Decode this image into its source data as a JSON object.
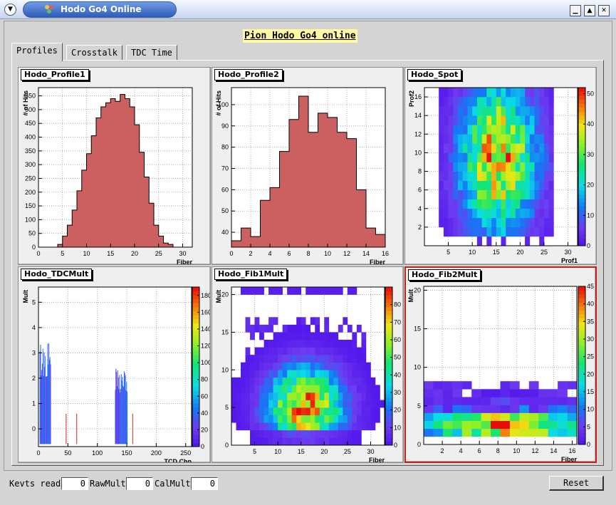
{
  "window": {
    "title": "Hodo Go4 Online"
  },
  "header": {
    "banner": "Pion Hodo Go4 online"
  },
  "tabs": [
    {
      "label": "Profiles",
      "active": true
    },
    {
      "label": "Crosstalk",
      "active": false
    },
    {
      "label": "TDC Time",
      "active": false
    }
  ],
  "pads": {
    "profile1": {
      "title": "Hodo_Profile1"
    },
    "profile2": {
      "title": "Hodo_Profile2"
    },
    "spot": {
      "title": "Hodo_Spot"
    },
    "tdcmult": {
      "title": "Hodo_TDCMult"
    },
    "fib1mult": {
      "title": "Hodo_Fib1Mult"
    },
    "fib2mult": {
      "title": "Hodo_Fib2Mult"
    }
  },
  "status": {
    "kevts_label": "Kevts read",
    "kevts_value": "0",
    "rawmult_label": "RawMult",
    "rawmult_value": "0",
    "calmult_label": "CalMult",
    "calmult_value": "0",
    "reset_label": "Reset"
  },
  "colors": {
    "hist_fill": "#cc6060",
    "selected_border": "#c81e1e",
    "banner_bg": "#fffaa0"
  },
  "chart_data": [
    {
      "type": "bar",
      "title": "Hodo_Profile1",
      "xlabel": "Fiber",
      "ylabel": "# of Hits",
      "xlim": [
        0,
        32
      ],
      "ylim": [
        0,
        580
      ],
      "xticks": [
        0,
        5,
        10,
        15,
        20,
        25,
        30
      ],
      "yticks": [
        0,
        50,
        100,
        150,
        200,
        250,
        300,
        350,
        400,
        450,
        500,
        550
      ],
      "bins": {
        "start": 0,
        "width": 1
      },
      "values": [
        0,
        0,
        0,
        0,
        10,
        40,
        80,
        135,
        205,
        280,
        340,
        405,
        470,
        510,
        525,
        540,
        530,
        555,
        540,
        510,
        445,
        345,
        255,
        160,
        80,
        40,
        15,
        10,
        0,
        0,
        0,
        0
      ]
    },
    {
      "type": "bar",
      "title": "Hodo_Profile2",
      "xlabel": "Fiber",
      "ylabel": "# of Hits",
      "xlim": [
        0,
        16
      ],
      "ylim": [
        33,
        108
      ],
      "xticks": [
        0,
        2,
        4,
        6,
        8,
        10,
        12,
        14,
        16
      ],
      "yticks": [
        40,
        50,
        60,
        70,
        80,
        90,
        100
      ],
      "bins": {
        "start": 0,
        "width": 1
      },
      "values": [
        36,
        42,
        38,
        55,
        61,
        78,
        93,
        104,
        87,
        96,
        94,
        87,
        84,
        60,
        42,
        39
      ]
    },
    {
      "type": "heatmap",
      "title": "Hodo_Spot",
      "xlabel": "Prof1",
      "ylabel": "Prof2",
      "xlim": [
        0,
        32
      ],
      "ylim": [
        0,
        17
      ],
      "zlim": [
        0,
        52
      ],
      "xticks": [
        5,
        10,
        15,
        20,
        25,
        30
      ],
      "yticks": [
        2,
        4,
        6,
        8,
        10,
        12,
        14,
        16
      ],
      "zticks": [
        0,
        10,
        20,
        30,
        40,
        50
      ],
      "cells": {
        "nx": 32,
        "ny": 17,
        "cx": 15.5,
        "cy": 9.5,
        "sx": 5.5,
        "sy": 5.5,
        "peak": 52,
        "min": 1.5
      }
    },
    {
      "type": "bar",
      "title": "Hodo_TDCMult",
      "xlabel": "TCD Chn",
      "ylabel": "Mult",
      "xlim": [
        0,
        260
      ],
      "ylim": [
        -0.7,
        5.6
      ],
      "xticks": [
        0,
        50,
        100,
        150,
        200,
        250
      ],
      "yticks": [
        0,
        1,
        2,
        3,
        4,
        5
      ],
      "zticks": [
        0,
        20,
        40,
        60,
        80,
        100,
        120,
        140,
        160,
        180
      ],
      "clusters": [
        {
          "from": 2,
          "to": 20,
          "height": 3.5
        },
        {
          "from": 130,
          "to": 150,
          "height": 2.4
        }
      ],
      "red_lines": [
        47,
        65,
        160
      ]
    },
    {
      "type": "heatmap",
      "title": "Hodo_Fib1Mult",
      "xlabel": "Fiber",
      "ylabel": "Mult",
      "xlim": [
        0,
        33
      ],
      "ylim": [
        0,
        21
      ],
      "zlim": [
        0,
        90
      ],
      "xticks": [
        5,
        10,
        15,
        20,
        25,
        30
      ],
      "yticks": [
        0,
        5,
        10,
        15,
        20
      ],
      "zticks": [
        0,
        10,
        20,
        30,
        40,
        50,
        60,
        70,
        80
      ],
      "cells": {
        "nx": 33,
        "ny": 21,
        "cx": 16,
        "cy": 5,
        "sx": 5.5,
        "sy": 3.6,
        "peak": 90,
        "min": 1
      }
    },
    {
      "type": "heatmap",
      "title": "Hodo_Fib2Mult",
      "xlabel": "Fiber",
      "ylabel": "Mult",
      "xlim": [
        0,
        16.5
      ],
      "ylim": [
        0,
        20.5
      ],
      "zlim": [
        0,
        45
      ],
      "xticks": [
        2,
        4,
        6,
        8,
        10,
        12,
        14,
        16
      ],
      "yticks": [
        0,
        5,
        10,
        15,
        20
      ],
      "zticks": [
        0,
        5,
        10,
        15,
        20,
        25,
        30,
        35,
        40,
        45
      ],
      "cells": {
        "nx": 16,
        "ny": 20,
        "cx": 9,
        "cy": 2.5,
        "sx": 6,
        "sy": 1.6,
        "peak": 45,
        "min": 1
      }
    }
  ]
}
